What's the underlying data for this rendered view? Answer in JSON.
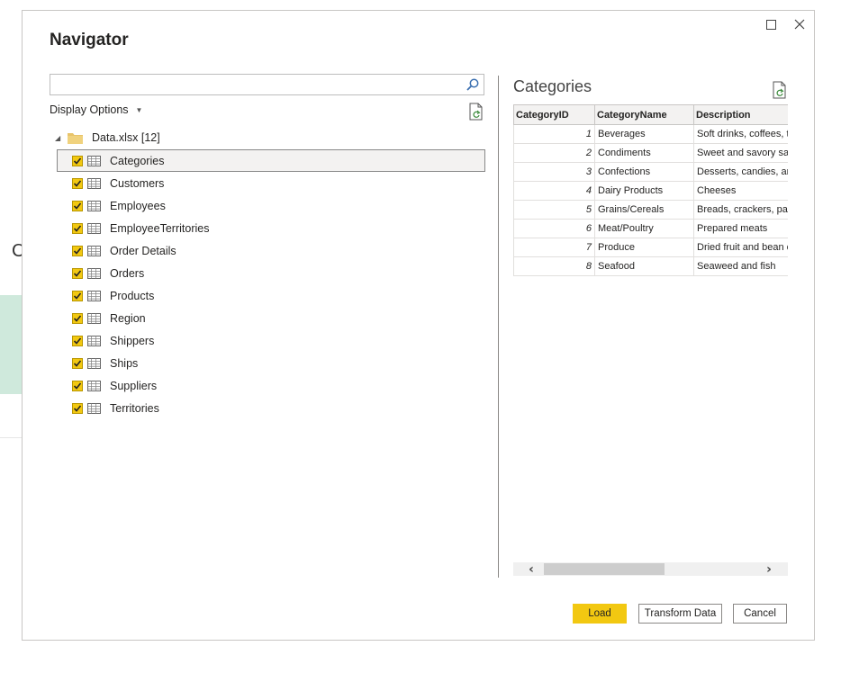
{
  "background": {
    "partial_letter": "C"
  },
  "dialog": {
    "title": "Navigator",
    "window_controls": [
      "maximize-icon",
      "close-icon"
    ]
  },
  "left": {
    "search": {
      "value": "",
      "placeholder": ""
    },
    "display_options": "Display Options",
    "root": {
      "label": "Data.xlsx [12]",
      "expanded": true
    },
    "items": [
      {
        "label": "Categories",
        "checked": true,
        "selected": true
      },
      {
        "label": "Customers",
        "checked": true
      },
      {
        "label": "Employees",
        "checked": true
      },
      {
        "label": "EmployeeTerritories",
        "checked": true
      },
      {
        "label": "Order Details",
        "checked": true
      },
      {
        "label": "Orders",
        "checked": true
      },
      {
        "label": "Products",
        "checked": true
      },
      {
        "label": "Region",
        "checked": true
      },
      {
        "label": "Shippers",
        "checked": true
      },
      {
        "label": "Ships",
        "checked": true
      },
      {
        "label": "Suppliers",
        "checked": true
      },
      {
        "label": "Territories",
        "checked": true
      }
    ]
  },
  "preview": {
    "title": "Categories",
    "columns": [
      "CategoryID",
      "CategoryName",
      "Description"
    ],
    "rows": [
      [
        "1",
        "Beverages",
        "Soft drinks, coffees, t"
      ],
      [
        "2",
        "Condiments",
        "Sweet and savory sau"
      ],
      [
        "3",
        "Confections",
        "Desserts, candies, an"
      ],
      [
        "4",
        "Dairy Products",
        "Cheeses"
      ],
      [
        "5",
        "Grains/Cereals",
        "Breads, crackers, pas"
      ],
      [
        "6",
        "Meat/Poultry",
        "Prepared meats"
      ],
      [
        "7",
        "Produce",
        "Dried fruit and bean c"
      ],
      [
        "8",
        "Seafood",
        "Seaweed and fish"
      ]
    ]
  },
  "buttons": {
    "load": "Load",
    "transform": "Transform Data",
    "cancel": "Cancel"
  },
  "colors": {
    "accent": "#f2c811",
    "border": "#c8c6c4"
  }
}
